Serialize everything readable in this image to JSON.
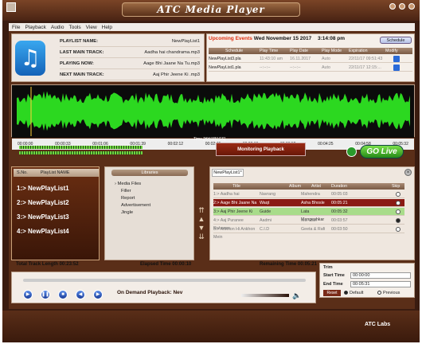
{
  "app": {
    "title": "ATC Media Player",
    "logo": "ATC Labs"
  },
  "menu": [
    "File",
    "Playback",
    "Audio",
    "Tools",
    "View",
    "Help"
  ],
  "info": {
    "rows": [
      {
        "label": "PLAYLIST NAME:",
        "value": "NewPlayList1"
      },
      {
        "label": "LAST MAIN TRACK:",
        "value": "Aadha hai chandrama.mp3"
      },
      {
        "label": "PLAYING NOW:",
        "value": "Aage Bhi Jaane Na Tu.mp3"
      },
      {
        "label": "NEXT MAIN TRACK:",
        "value": "Aaj Phir Jeene Ki .mp3"
      }
    ]
  },
  "schedule": {
    "label": "Upcoming Events",
    "date": "Wed November 15 2017",
    "time": "3:14:08 pm",
    "button": "Schedule",
    "headers": [
      "Schedule",
      "Play Time",
      "Play Date",
      "Play Mode",
      "Expiration",
      "Modify"
    ],
    "rows": [
      [
        "NewPlayList3.pla",
        "11:43:10 am",
        "16.11.2017",
        "Auto",
        "22/11/17 09:51:43"
      ],
      [
        "NewPlayList1.pla",
        "--:--:--",
        "--:--:--",
        "Auto",
        "22/11/17 12:15:..."
      ]
    ]
  },
  "ruler": [
    "00:00:00",
    "00:00:33",
    "00:01:06",
    "00:01:39",
    "00:02:12",
    "00:02:46",
    "00:03:19",
    "00:03:52",
    "00:04:25",
    "00:04:58",
    "00:05:32"
  ],
  "time_axis_label": "Time [HH:MM:SS]",
  "monitoring": "Monitoring Playback",
  "go_live": "GO Live",
  "playlists": {
    "headers": [
      "S.No.",
      "PlayList NAME"
    ],
    "items": [
      "1:> NewPlayList1",
      "2:> NewPlayList2",
      "3:> NewPlayList3",
      "4:> NewPlayList4"
    ]
  },
  "library": {
    "title": "Libraries",
    "items": [
      "Media Files",
      "Filler",
      "Report",
      "Advertisement",
      "Jingle"
    ]
  },
  "tracks": {
    "tab": "NewPlayList1*",
    "headers": [
      "Title",
      "Album",
      "Artist",
      "Duration",
      "Skip"
    ],
    "rows": [
      [
        "1:> Aadha hai chandrama",
        "Navrang",
        "Mahendra Kap...",
        "00:05:03"
      ],
      [
        "2:> Aage Bhi Jaane Na Tu",
        "Waqt",
        "Asha Bhosle",
        "00:05:21"
      ],
      [
        "3:> Aaj Phir Jeene Ki",
        "Guide",
        "Lata Mangeshkar",
        "00:05:32"
      ],
      [
        "4:> Aaj Puranee Rahonse",
        "Aadmi",
        "Md. Rafi",
        "00:03:57"
      ],
      [
        "5:> Ankhon Hi Ankhon Mein",
        "C.I.D",
        "Geeta & Rafi",
        "00:03:50"
      ]
    ]
  },
  "status": {
    "total": "Total Track Length 00:23:52",
    "elapsed": "Elapsed Time 00:00:10",
    "remaining": "Remaining Time 00:05:21"
  },
  "playback": {
    "mode": "On Demand Playback: Nev"
  },
  "trim": {
    "title": "Trim",
    "start_label": "Start Time",
    "start": "00:00:00",
    "end_label": "End Time",
    "end": "00:05:31",
    "reset": "Reset",
    "default": "Default",
    "previous": "Previous"
  }
}
